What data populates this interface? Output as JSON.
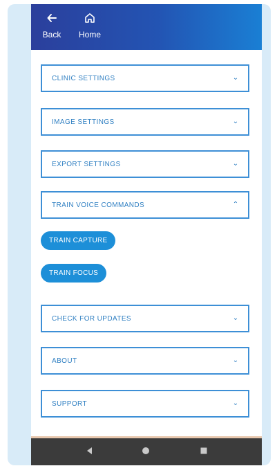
{
  "header": {
    "back_label": "Back",
    "home_label": "Home",
    "back_icon": "arrow-left-icon",
    "home_icon": "home-icon"
  },
  "sections": [
    {
      "label": "CLINIC SETTINGS",
      "icon": "chevron-down-icon",
      "expanded": false
    },
    {
      "label": "IMAGE SETTINGS",
      "icon": "chevron-down-icon",
      "expanded": false
    },
    {
      "label": "EXPORT SETTINGS",
      "icon": "chevron-down-icon",
      "expanded": false
    },
    {
      "label": "TRAIN VOICE COMMANDS",
      "icon": "chevron-up-icon",
      "expanded": true
    },
    {
      "label": "CHECK FOR UPDATES",
      "icon": "chevron-down-icon",
      "expanded": false
    },
    {
      "label": "ABOUT",
      "icon": "chevron-down-icon",
      "expanded": false
    },
    {
      "label": "SUPPORT",
      "icon": "chevron-down-icon",
      "expanded": false
    }
  ],
  "voice_commands": {
    "train_capture": "TRAIN CAPTURE",
    "train_focus": "TRAIN FOCUS"
  },
  "system_nav": {
    "back_icon": "triangle-back-icon",
    "home_icon": "circle-home-icon",
    "recent_icon": "square-recent-icon"
  },
  "colors": {
    "accent": "#1d8fd8",
    "border": "#3d8fd6",
    "header_start": "#2b3f9c",
    "header_end": "#1a7fd4",
    "nav_bar": "#3b3b3b"
  }
}
